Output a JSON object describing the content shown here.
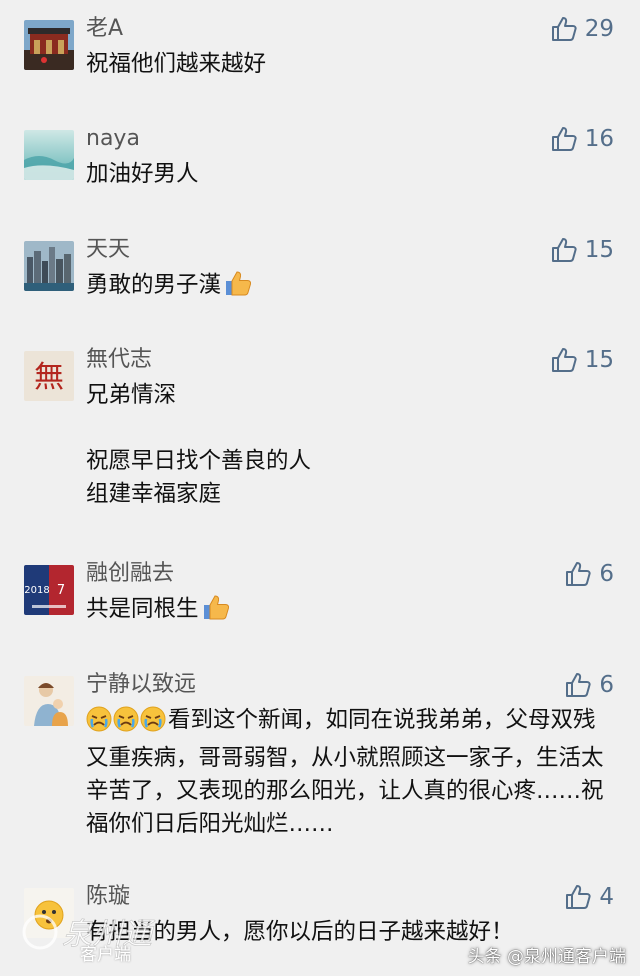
{
  "comments": [
    {
      "name": "老A",
      "likes": "29",
      "text": "祝福他们越来越好"
    },
    {
      "name": "naya",
      "likes": "16",
      "text": "加油好男人"
    },
    {
      "name": "天天",
      "likes": "15",
      "text": "勇敢的男子漢"
    },
    {
      "name": "無代志",
      "likes": "15",
      "text": "兄弟情深\n\n祝愿早日找个善良的人\n组建幸福家庭"
    },
    {
      "name": "融创融去",
      "likes": "6",
      "text": "共是同根生"
    },
    {
      "name": "宁静以致远",
      "likes": "6",
      "text": "看到这个新闻，如同在说我弟弟，父母双残又重疾病，哥哥弱智，从小就照顾这一家子，生活太辛苦了，又表现的那么阳光，让人真的很心疼……祝福你们日后阳光灿烂……"
    },
    {
      "name": "陈璇",
      "likes": "4",
      "text": "有担当的男人，愿你以后的日子越来越好！"
    }
  ],
  "avatar_texts": {
    "wu": "無",
    "rongchuang_left": "2018",
    "rongchuang_right": "7"
  },
  "watermark": {
    "logo_text": "泉州通",
    "sub_text": "客户端"
  },
  "source_label": "头条 @泉州通客户端",
  "colors": {
    "background": "#f0f0f0",
    "like_icon": "#546e8a",
    "name": "#555555"
  }
}
